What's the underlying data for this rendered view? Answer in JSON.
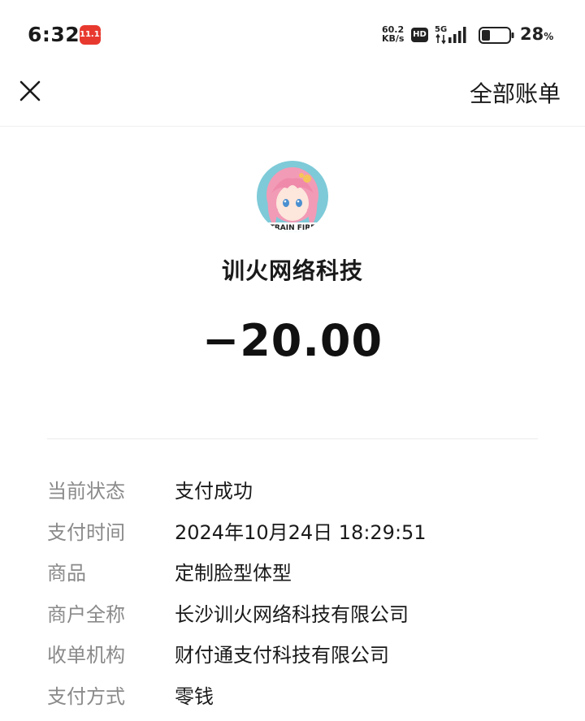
{
  "status_bar": {
    "time": "6:32",
    "app_badge": "11.11",
    "net_speed_value": "60.2",
    "net_speed_unit": "KB/s",
    "hd": "HD",
    "network": "5G",
    "battery_percent": "28",
    "battery_unit": "%"
  },
  "nav": {
    "close_icon": "close-icon",
    "all_bills_label": "全部账单"
  },
  "merchant": {
    "avatar_text": "TRAIN FIRE",
    "name": "训火网络科技",
    "amount": "−20.00"
  },
  "details": [
    {
      "label": "当前状态",
      "value": "支付成功"
    },
    {
      "label": "支付时间",
      "value": "2024年10月24日 18:29:51"
    },
    {
      "label": "商品",
      "value": "定制脸型体型"
    },
    {
      "label": "商户全称",
      "value": "长沙训火网络科技有限公司"
    },
    {
      "label": "收单机构",
      "value": "财付通支付科技有限公司"
    },
    {
      "label": "支付方式",
      "value": "零钱"
    }
  ],
  "colors": {
    "background": "#ffffff",
    "label": "#8a8a8a",
    "text": "#1a1a1a",
    "badge_red": "#e8392f"
  }
}
